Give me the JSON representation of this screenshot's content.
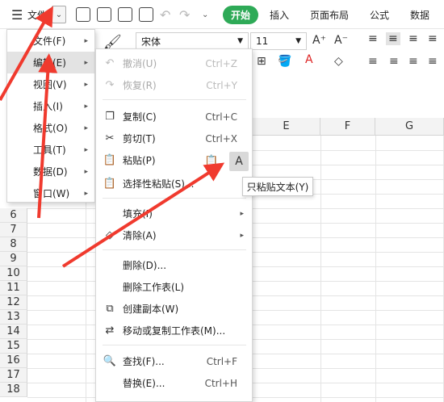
{
  "toolbar": {
    "file_label": "文件",
    "tabs": [
      "开始",
      "插入",
      "页面布局",
      "公式",
      "数据"
    ]
  },
  "ribbon": {
    "font_name": "宋体",
    "font_size": "11"
  },
  "columns": [
    "E",
    "F",
    "G"
  ],
  "rows": [
    "6",
    "7",
    "8",
    "9",
    "10",
    "11",
    "12",
    "13",
    "14",
    "15",
    "16",
    "17",
    "18"
  ],
  "menu": {
    "items": [
      {
        "label": "文件(F)"
      },
      {
        "label": "编辑(E)"
      },
      {
        "label": "视图(V)"
      },
      {
        "label": "插入(I)"
      },
      {
        "label": "格式(O)"
      },
      {
        "label": "工具(T)"
      },
      {
        "label": "数据(D)"
      },
      {
        "label": "窗口(W)"
      }
    ]
  },
  "submenu": {
    "undo": {
      "label": "撤消(U)",
      "shortcut": "Ctrl+Z"
    },
    "redo": {
      "label": "恢复(R)",
      "shortcut": "Ctrl+Y"
    },
    "copy": {
      "label": "复制(C)",
      "shortcut": "Ctrl+C"
    },
    "cut": {
      "label": "剪切(T)",
      "shortcut": "Ctrl+X"
    },
    "paste": {
      "label": "粘贴(P)"
    },
    "paste_special": {
      "label": "选择性粘贴(S)..."
    },
    "fill": {
      "label": "填充(I)"
    },
    "clear": {
      "label": "清除(A)"
    },
    "delete": {
      "label": "删除(D)..."
    },
    "delete_sheet": {
      "label": "删除工作表(L)"
    },
    "create_copy": {
      "label": "创建副本(W)"
    },
    "move_copy_sheet": {
      "label": "移动或复制工作表(M)..."
    },
    "find": {
      "label": "查找(F)...",
      "shortcut": "Ctrl+F"
    },
    "replace": {
      "label": "替换(E)...",
      "shortcut": "Ctrl+H"
    }
  },
  "tooltip": {
    "text": "只粘贴文本(Y)"
  },
  "colors": {
    "accent": "#2eaa57",
    "annotation": "#f03a2e"
  }
}
